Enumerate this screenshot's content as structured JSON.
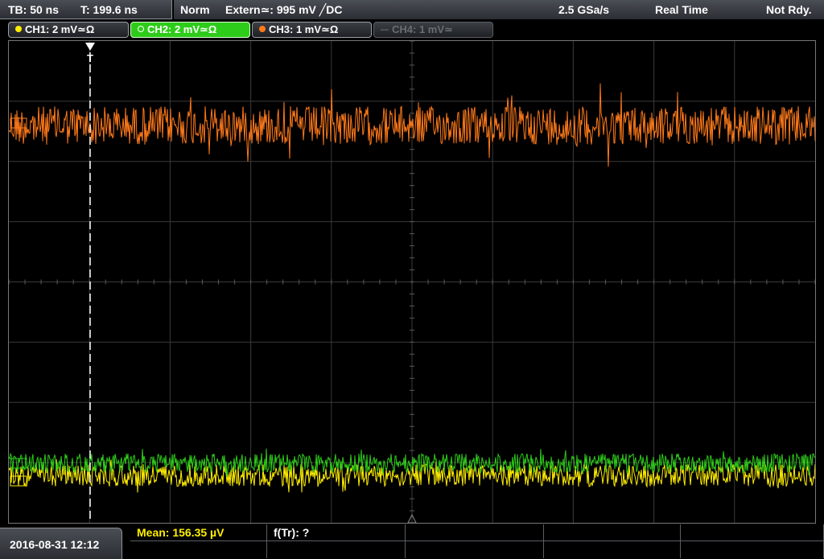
{
  "timebase": {
    "tb_label": "TB: 50 ns",
    "t_label": "T: 199.6 ns"
  },
  "status": {
    "trigger_mode": "Norm",
    "trigger_source": "Extern≃: 995 mV ╱DC",
    "sample_rate": "2.5 GSa/s",
    "acq_mode": "Real Time",
    "state": "Not Rdy."
  },
  "channels": [
    {
      "label": "CH1: 2 mV≃Ω",
      "color": "#ffee00",
      "state": "enabled"
    },
    {
      "label": "CH2: 2 mV≃Ω",
      "color": "#2ecc1a",
      "state": "active"
    },
    {
      "label": "CH3: 1 mV≃Ω",
      "color": "#ff7a1a",
      "state": "enabled"
    },
    {
      "label": "CH4: 1 mV≃",
      "color": "#6a6d72",
      "state": "disabled"
    }
  ],
  "trigger_marker": "T",
  "measurements": {
    "mean_label": "Mean: 156.35 µV",
    "mean_color": "#ffee00",
    "ftr_label": "f(Tr): ?"
  },
  "datetime": "2016-08-31 12:12",
  "colors": {
    "grid": "#3a3a3a",
    "trigger_line": "#ffffff",
    "ch1": "#ffee00",
    "ch2": "#2ecc1a",
    "ch3": "#ff7a1a"
  }
}
